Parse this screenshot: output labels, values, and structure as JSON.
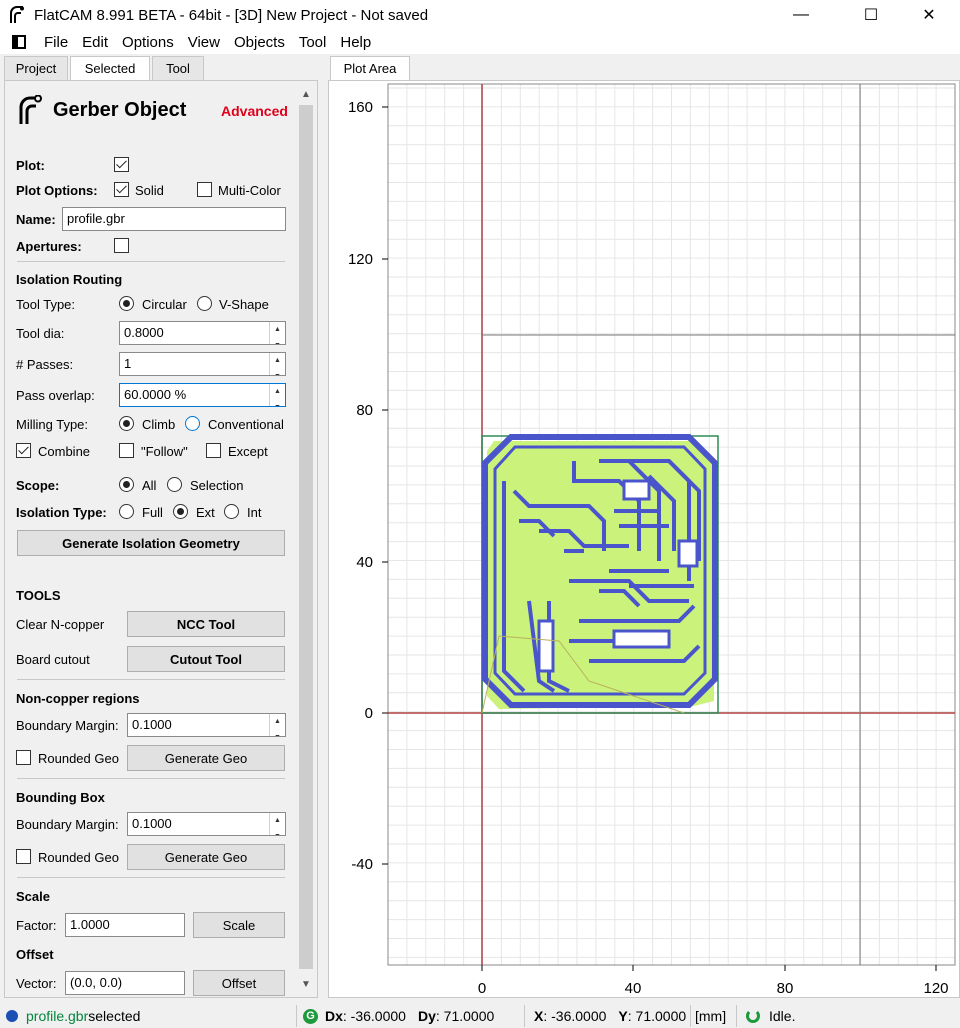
{
  "window": {
    "title": "FlatCAM 8.991 BETA - 64bit - [3D]    New Project - Not saved",
    "minimize": "—",
    "maximize": "☐",
    "close": "✕"
  },
  "menu": [
    "File",
    "Edit",
    "Options",
    "View",
    "Objects",
    "Tool",
    "Help"
  ],
  "tabs": {
    "project": "Project",
    "selected": "Selected",
    "tool": "Tool"
  },
  "panel": {
    "title": "Gerber Object",
    "advanced": "Advanced",
    "plot_label": "Plot:",
    "plot_options_label": "Plot Options:",
    "solid_label": "Solid",
    "multicolor_label": "Multi-Color",
    "name_label": "Name:",
    "name_value": "profile.gbr",
    "apertures_label": "Apertures:",
    "isolation_heading": "Isolation Routing",
    "tool_type_label": "Tool Type:",
    "circular_label": "Circular",
    "vshape_label": "V-Shape",
    "tool_dia_label": "Tool dia:",
    "tool_dia_value": "0.8000",
    "passes_label": "# Passes:",
    "passes_value": "1",
    "overlap_label": "Pass overlap:",
    "overlap_value": "60.0000 %",
    "milling_label": "Milling Type:",
    "climb_label": "Climb",
    "conventional_label": "Conventional",
    "combine_label": "Combine",
    "follow_label": "\"Follow\"",
    "except_label": "Except",
    "scope_label": "Scope:",
    "all_label": "All",
    "selection_label": "Selection",
    "iso_type_label": "Isolation Type:",
    "full_label": "Full",
    "ext_label": "Ext",
    "int_label": "Int",
    "generate_iso_button": "Generate Isolation Geometry",
    "tools_heading": "TOOLS",
    "clear_ncopper_label": "Clear N-copper",
    "ncc_button": "NCC Tool",
    "board_cutout_label": "Board cutout",
    "cutout_button": "Cutout Tool",
    "noncopper_heading": "Non-copper regions",
    "boundary_margin_label": "Boundary Margin:",
    "noncopper_margin_value": "0.1000",
    "rounded_geo_label": "Rounded Geo",
    "generate_geo_button": "Generate Geo",
    "bbox_heading": "Bounding Box",
    "bbox_margin_value": "0.1000",
    "scale_heading": "Scale",
    "factor_label": "Factor:",
    "factor_value": "1.0000",
    "scale_button": "Scale",
    "offset_heading": "Offset",
    "vector_label": "Vector:",
    "vector_value": "(0.0, 0.0)",
    "offset_button": "Offset"
  },
  "plot": {
    "tab_label": "Plot Area",
    "y_ticks": [
      "160",
      "120",
      "80",
      "40",
      "0",
      "-40"
    ],
    "x_ticks": [
      "0",
      "40",
      "80",
      "120"
    ],
    "colors": {
      "axis": "#b04040",
      "trace": "#4a55cc",
      "fill": "#cbf27a",
      "grid": "#e6e6e6",
      "label": "#8b1a1a"
    }
  },
  "status": {
    "object": "profile.gbr",
    "selected_text": " selected",
    "dx_label": "Dx",
    "dx_value": ": -36.0000",
    "dy_label": "Dy",
    "dy_value": ": 71.0000",
    "x_label": "X",
    "x_value": ": -36.0000",
    "y_label": "Y",
    "y_value": ": 71.0000",
    "units": "[mm]",
    "state": "Idle."
  }
}
